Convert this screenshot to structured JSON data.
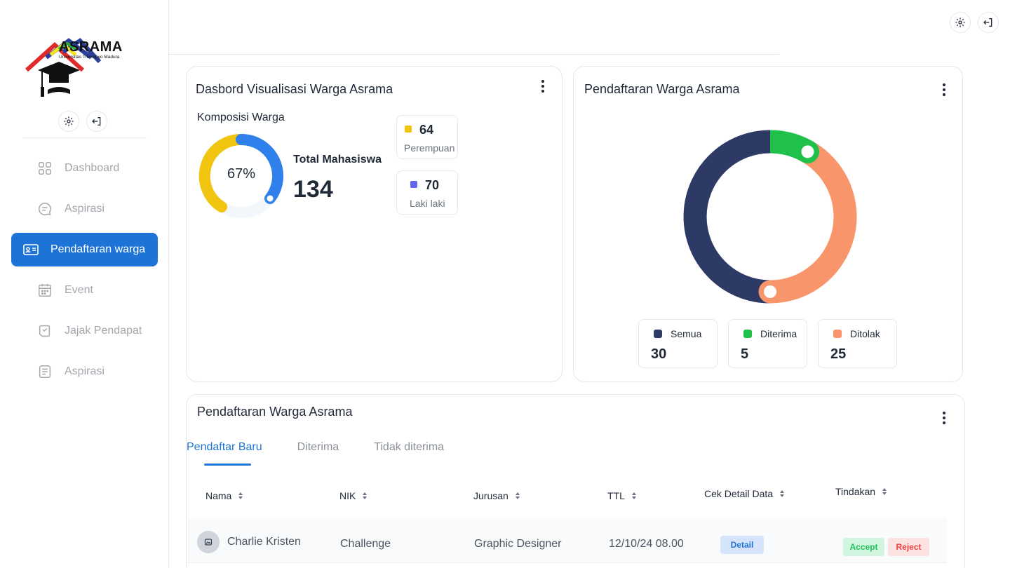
{
  "sidebar": {
    "logo_title": "ASRAMA",
    "logo_subtitle": "Universitas Trunojoyo Madura",
    "items": [
      {
        "label": "Dashboard",
        "icon": "grid-icon"
      },
      {
        "label": "Aspirasi",
        "icon": "chat-icon"
      },
      {
        "label": "Pendaftaran warga",
        "icon": "id-card-icon",
        "active": true
      },
      {
        "label": "Event",
        "icon": "calendar-icon"
      },
      {
        "label": "Jajak Pendapat",
        "icon": "poll-icon"
      },
      {
        "label": "Aspirasi",
        "icon": "document-icon"
      }
    ]
  },
  "visualisasi": {
    "title": "Dasbord Visualisasi Warga Asrama",
    "subtitle": "Komposisi Warga",
    "percent_label": "67%",
    "total_label": "Total Mahasiswa",
    "total_value": "134",
    "perempuan": {
      "value": "64",
      "label": "Perempuan",
      "color": "#f1c40f"
    },
    "laki": {
      "value": "70",
      "label": "Laki laki",
      "color": "#6366f1"
    }
  },
  "pendaftaran_chart": {
    "title": "Pendaftaran Warga Asrama",
    "legend": [
      {
        "label": "Semua",
        "value": "30",
        "color": "#2d3a66"
      },
      {
        "label": "Diterima",
        "value": "5",
        "color": "#1fc14a"
      },
      {
        "label": "Ditolak",
        "value": "25",
        "color": "#f9956b"
      }
    ]
  },
  "table_card": {
    "title": "Pendaftaran Warga Asrama",
    "tabs": [
      "Pendaftar Baru",
      "Diterima",
      "Tidak diterima"
    ],
    "columns": [
      "Nama",
      "NIK",
      "Jurusan",
      "TTL",
      "Cek Detail Data",
      "Tindakan"
    ],
    "rows": [
      {
        "nama": "Charlie Kristen",
        "nik": "Challenge",
        "jurusan": "Graphic Designer",
        "ttl": "12/10/24 08.00",
        "detail": "Detail",
        "accept": "Accept",
        "reject": "Reject"
      }
    ]
  },
  "chart_data": {
    "type": "pie",
    "categories": [
      "Semua",
      "Diterima",
      "Ditolak"
    ],
    "values": [
      30,
      5,
      25
    ],
    "title": "Pendaftaran Warga Asrama"
  },
  "colors": {
    "accent": "#1e74d6",
    "navy": "#2d3a66",
    "green": "#1fc14a",
    "orange": "#f9956b",
    "yellow": "#f1c40f",
    "blue": "#2f80ed"
  }
}
